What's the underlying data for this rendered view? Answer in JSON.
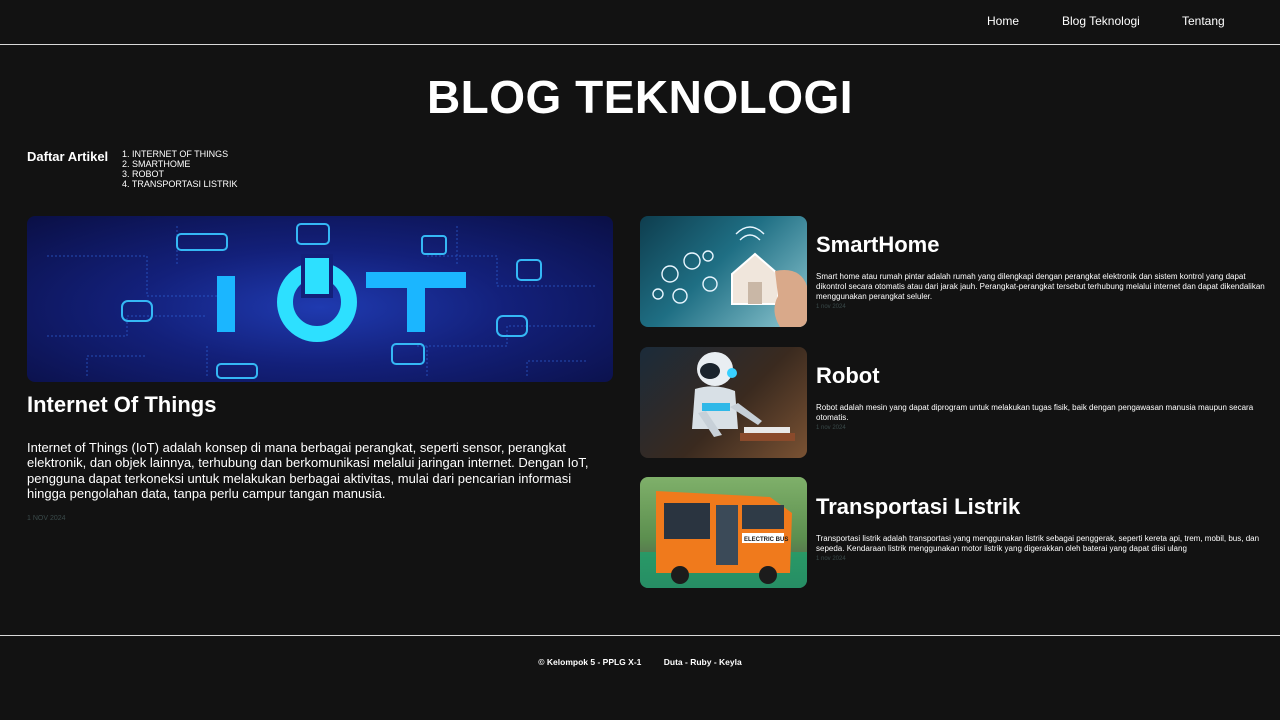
{
  "nav": {
    "home": "Home",
    "blog": "Blog Teknologi",
    "about": "Tentang"
  },
  "page_title": "BLOG TEKNOLOGI",
  "toc": {
    "label": "Daftar Artikel",
    "items": [
      "1. INTERNET OF THINGS",
      "2. SMARTHOME",
      "3. ROBOT",
      "4. TRANSPORTASI LISTRIK"
    ]
  },
  "featured": {
    "image_text": "IOT",
    "title": "Internet Of Things",
    "body": "Internet of Things (IoT) adalah konsep di mana berbagai perangkat, seperti sensor, perangkat elektronik, dan objek lainnya, terhubung dan berkomunikasi melalui jaringan internet. Dengan IoT, pengguna dapat terkoneksi untuk melakukan berbagai aktivitas, mulai dari pencarian informasi hingga pengolahan data, tanpa perlu campur tangan manusia.",
    "date": "1 NOV 2024"
  },
  "cards": [
    {
      "title": "SmartHome",
      "body": "Smart home atau rumah pintar adalah rumah yang dilengkapi dengan perangkat elektronik dan sistem kontrol yang dapat dikontrol secara otomatis atau dari jarak jauh. Perangkat-perangkat tersebut terhubung melalui internet dan dapat dikendalikan menggunakan perangkat seluler.",
      "date": "1 nov 2024"
    },
    {
      "title": "Robot",
      "body": "Robot adalah mesin yang dapat diprogram untuk melakukan tugas fisik, baik dengan pengawasan manusia maupun secara otomatis.",
      "date": "1 nov 2024"
    },
    {
      "title": "Transportasi Listrik",
      "body": "Transportasi listrik adalah transportasi yang menggunakan listrik sebagai penggerak, seperti kereta api, trem, mobil, bus, dan sepeda. Kendaraan listrik menggunakan motor listrik yang digerakkan oleh baterai yang dapat diisi ulang",
      "date": "1 nov 2024",
      "image_text": "ELECTRIC BUS"
    }
  ],
  "footer": {
    "copyright": "© Kelompok 5 - PPLG X-1",
    "authors": "Duta - Ruby - Keyla"
  }
}
